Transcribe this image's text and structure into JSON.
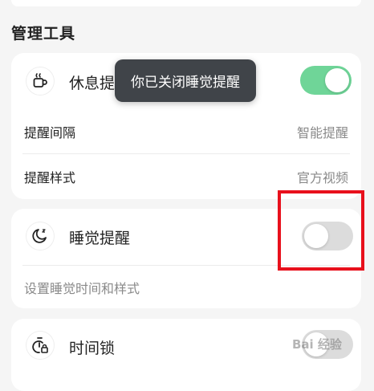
{
  "section": {
    "title": "管理工具"
  },
  "rest_reminder": {
    "title": "休息提醒",
    "enabled": true,
    "interval_label": "提醒间隔",
    "interval_value": "智能提醒",
    "style_label": "提醒样式",
    "style_value": "官方视频"
  },
  "sleep_reminder": {
    "title": "睡觉提醒",
    "enabled": false,
    "hint": "设置睡觉时间和样式"
  },
  "time_lock": {
    "title": "时间锁",
    "enabled": false
  },
  "toast": {
    "message": "你已关闭睡觉提醒"
  },
  "watermark": {
    "text": "Bai 经验"
  },
  "colors": {
    "toggle_on": "#6fd598",
    "toggle_off": "#dcdcdc",
    "highlight_box": "#e8101c",
    "toast_bg": "#404449"
  },
  "icons": {
    "rest": "coffee-cup-icon",
    "sleep": "moon-icon",
    "time_lock": "timer-lock-icon"
  }
}
